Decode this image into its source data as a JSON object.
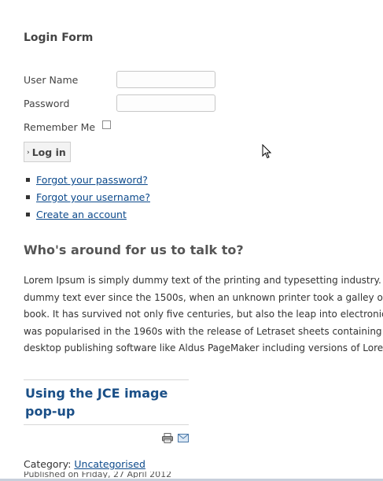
{
  "login_form": {
    "title": "Login Form",
    "username_label": "User Name",
    "username_value": "",
    "password_label": "Password",
    "password_value": "",
    "remember_label": "Remember Me",
    "remember_checked": false,
    "login_button_label": "Log in",
    "links": [
      {
        "label": "Forgot your password?"
      },
      {
        "label": "Forgot your username?"
      },
      {
        "label": "Create an account"
      }
    ]
  },
  "who_section": {
    "heading": "Who's around for us to talk to?",
    "lines": [
      "Lorem Ipsum is simply dummy text of the printing and typesetting industry. Lorem Ipsum has been the industry's standard",
      "dummy text ever since the 1500s, when an unknown printer took a galley of type and scrambled it to make a type specimen",
      "book. It has survived not only five centuries, but also the leap into electronic typesetting, remaining essentially unchanged. It",
      "was popularised in the 1960s with the release of Letraset sheets containing Lorem Ipsum passages, and more recently with",
      "desktop publishing software like Aldus PageMaker including versions of Lorem Ipsum."
    ]
  },
  "article": {
    "title": "Using the JCE image pop-up",
    "print_icon": "printer-icon",
    "email_icon": "email-icon",
    "category_label": "Category: ",
    "category_link": "Uncategorised",
    "published_text": "Published on Friday, 27 April 2012"
  }
}
